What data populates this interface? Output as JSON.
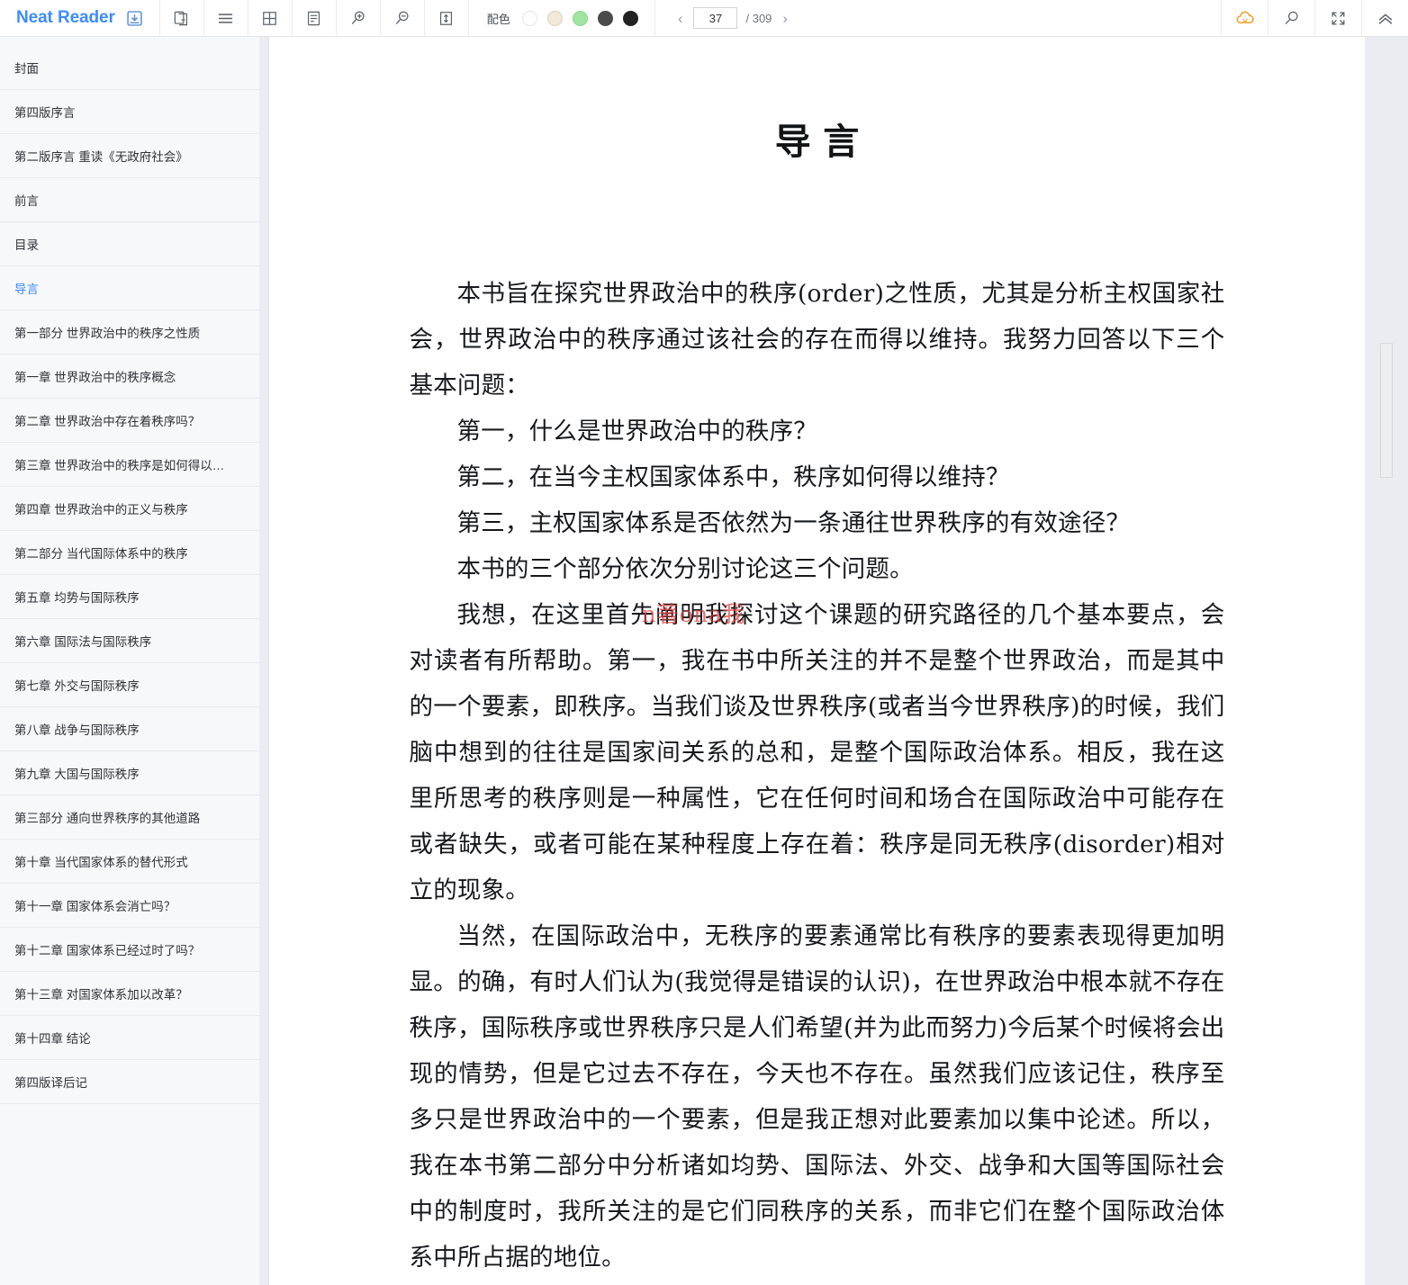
{
  "app": {
    "brand": "Neat Reader"
  },
  "toolbar": {
    "save_icon": "save-to-shelf-icon",
    "buttons": [
      {
        "name": "copy-book-icon",
        "title": "双页/复制"
      },
      {
        "name": "menu-lines-icon",
        "title": "目录"
      },
      {
        "name": "grid-layout-icon",
        "title": "网格视图"
      },
      {
        "name": "note-panel-icon",
        "title": "笔记"
      },
      {
        "name": "zoom-in-icon",
        "title": "放大"
      },
      {
        "name": "zoom-out-icon",
        "title": "缩小"
      },
      {
        "name": "line-height-icon",
        "title": "行高"
      }
    ],
    "scheme": {
      "label": "配色",
      "swatches": [
        {
          "name": "scheme-white",
          "color": "#ffffff"
        },
        {
          "name": "scheme-sepia",
          "color": "#f2e9d8"
        },
        {
          "name": "scheme-green",
          "color": "#9ee6a0"
        },
        {
          "name": "scheme-dark-gray",
          "color": "#4a4a4a"
        },
        {
          "name": "scheme-black",
          "color": "#222222"
        }
      ]
    },
    "pager": {
      "prev": "‹",
      "next": "›",
      "current_page": "37",
      "total": "/ 309"
    },
    "right_buttons": [
      {
        "name": "cloud-sync-icon",
        "title": "云同步"
      },
      {
        "name": "search-icon",
        "title": "搜索"
      },
      {
        "name": "fullscreen-icon",
        "title": "全屏"
      },
      {
        "name": "collapse-toolbar-icon",
        "title": "收起工具栏"
      }
    ]
  },
  "sidebar": {
    "items": [
      {
        "label": "封面",
        "active": false
      },
      {
        "label": "第四版序言",
        "active": false
      },
      {
        "label": "第二版序言 重读《无政府社会》",
        "active": false
      },
      {
        "label": "前言",
        "active": false
      },
      {
        "label": "目录",
        "active": false
      },
      {
        "label": "导言",
        "active": true
      },
      {
        "label": "第一部分 世界政治中的秩序之性质",
        "active": false
      },
      {
        "label": "第一章 世界政治中的秩序概念",
        "active": false
      },
      {
        "label": "第二章 世界政治中存在着秩序吗？",
        "active": false
      },
      {
        "label": "第三章 世界政治中的秩序是如何得以…",
        "active": false
      },
      {
        "label": "第四章 世界政治中的正义与秩序",
        "active": false
      },
      {
        "label": "第二部分 当代国际体系中的秩序",
        "active": false
      },
      {
        "label": "第五章 均势与国际秩序",
        "active": false
      },
      {
        "label": "第六章 国际法与国际秩序",
        "active": false
      },
      {
        "label": "第七章 外交与国际秩序",
        "active": false
      },
      {
        "label": "第八章 战争与国际秩序",
        "active": false
      },
      {
        "label": "第九章 大国与国际秩序",
        "active": false
      },
      {
        "label": "第三部分 通向世界秩序的其他道路",
        "active": false
      },
      {
        "label": "第十章 当代国家体系的替代形式",
        "active": false
      },
      {
        "label": "第十一章 国家体系会消亡吗？",
        "active": false
      },
      {
        "label": "第十二章 国家体系已经过时了吗？",
        "active": false
      },
      {
        "label": "第十三章 对国家体系加以改革？",
        "active": false
      },
      {
        "label": "第十四章 结论",
        "active": false
      },
      {
        "label": "第四版译后记",
        "active": false
      }
    ]
  },
  "page": {
    "title": "导言",
    "watermark": "n著ona我",
    "paragraphs": [
      {
        "kind": "indent",
        "text": "本书旨在探究世界政治中的秩序(order)之性质，尤其是分析主权国家社会，世界政治中的秩序通过该社会的存在而得以维持。我努力回答以下三个基本问题："
      },
      {
        "kind": "q",
        "text": "第一，什么是世界政治中的秩序？"
      },
      {
        "kind": "q",
        "text": "第二，在当今主权国家体系中，秩序如何得以维持？"
      },
      {
        "kind": "q",
        "text": "第三，主权国家体系是否依然为一条通往世界秩序的有效途径？"
      },
      {
        "kind": "q",
        "text": "本书的三个部分依次分别讨论这三个问题。"
      },
      {
        "kind": "indent",
        "text": "我想，在这里首先阐明我探讨这个课题的研究路径的几个基本要点，会对读者有所帮助。第一，我在书中所关注的并不是整个世界政治，而是其中的一个要素，即秩序。当我们谈及世界秩序(或者当今世界秩序)的时候，我们脑中想到的往往是国家间关系的总和，是整个国际政治体系。相反，我在这里所思考的秩序则是一种属性，它在任何时间和场合在国际政治中可能存在或者缺失，或者可能在某种程度上存在着：秩序是同无秩序(disorder)相对立的现象。"
      },
      {
        "kind": "indent",
        "text": "当然，在国际政治中，无秩序的要素通常比有秩序的要素表现得更加明显。的确，有时人们认为(我觉得是错误的认识)，在世界政治中根本就不存在秩序，国际秩序或世界秩序只是人们希望(并为此而努力)今后某个时候将会出现的情势，但是它过去不存在，今天也不存在。虽然我们应该记住，秩序至多只是世界政治中的一个要素，但是我正想对此要素加以集中论述。所以，我在本书第二部分中分析诸如均势、国际法、外交、战争和大国等国际社会中的制度时，我所关注的是它们同秩序的关系，而非它们在整个国际政治体系中所占据的地位。"
      }
    ]
  }
}
